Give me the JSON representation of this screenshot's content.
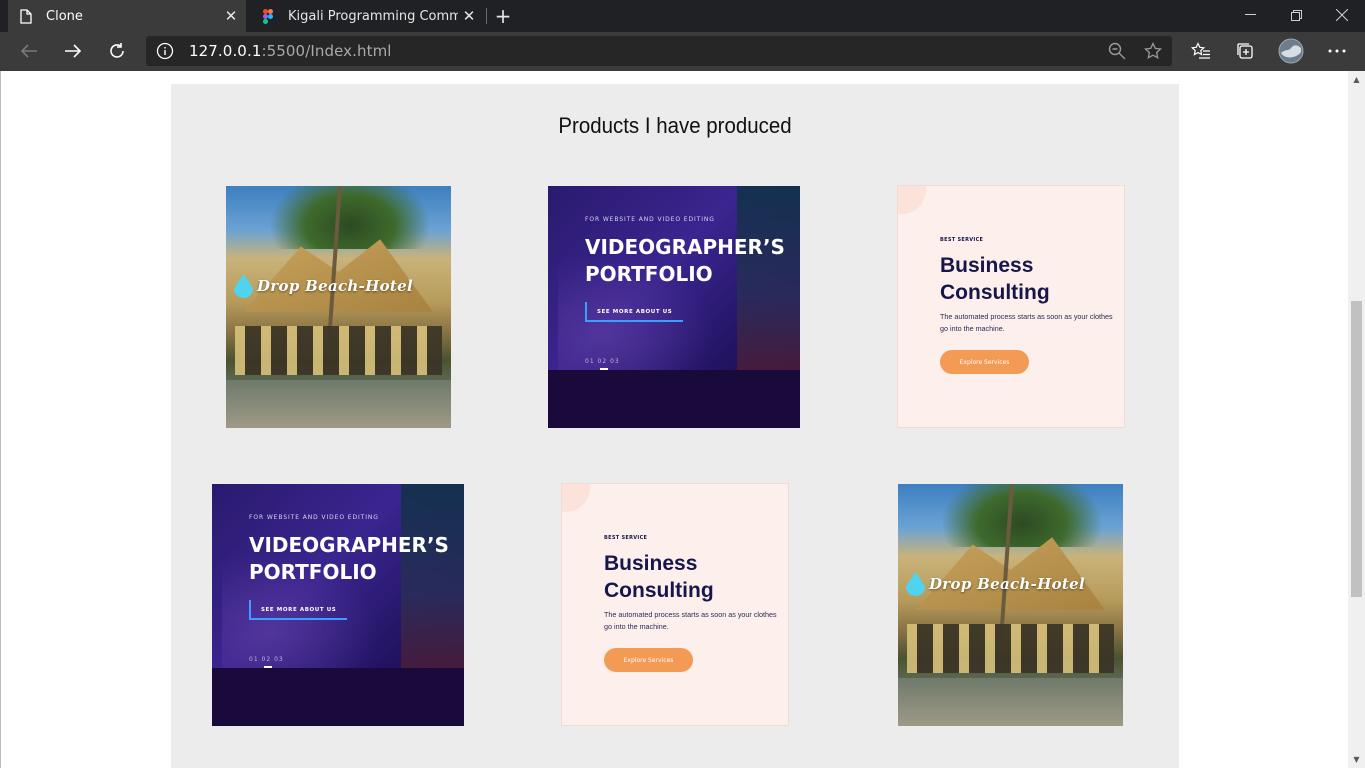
{
  "browser": {
    "tabs": [
      {
        "title": "Clone",
        "icon": "page-icon",
        "active": true
      },
      {
        "title": "Kigali Programming Community",
        "icon": "figma-icon",
        "active": false
      }
    ],
    "address": {
      "host": "127.0.0.1",
      "rest": ":5500/Index.html"
    }
  },
  "page": {
    "section_title": "Products I have produced",
    "products": [
      {
        "kind": "hotel",
        "brand": "Drop Beach-Hotel"
      },
      {
        "kind": "video",
        "eyebrow": "FOR WEBSITE AND VIDEO EDITING",
        "line1": "VIDEOGRAPHER’S",
        "line2": "PORTFOLIO",
        "cta": "SEE MORE ABOUT US",
        "pager": "01  02  03"
      },
      {
        "kind": "biz",
        "eyebrow": "BEST SERVICE",
        "line1": "Business",
        "line2": "Consulting",
        "desc": "The automated process starts as soon as your clothes go into the machine.",
        "button": "Explore Services"
      },
      {
        "kind": "video",
        "eyebrow": "FOR WEBSITE AND VIDEO EDITING",
        "line1": "VIDEOGRAPHER’S",
        "line2": "PORTFOLIO",
        "cta": "SEE MORE ABOUT US",
        "pager": "01  02  03"
      },
      {
        "kind": "biz",
        "eyebrow": "BEST SERVICE",
        "line1": "Business",
        "line2": "Consulting",
        "desc": "The automated process starts as soon as your clothes go into the machine.",
        "button": "Explore Services"
      },
      {
        "kind": "hotel",
        "brand": "Drop Beach-Hotel"
      }
    ]
  },
  "colors": {
    "section_bg": "#ececec",
    "accent_orange": "#f39a55",
    "navy": "#16164a"
  }
}
